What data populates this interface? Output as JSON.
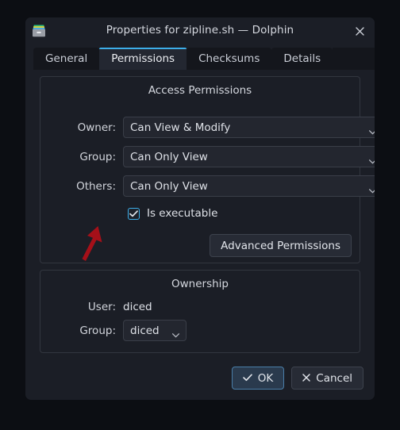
{
  "window": {
    "title": "Properties for zipline.sh — Dolphin",
    "icon": "file-properties-icon",
    "close_label": "✕"
  },
  "tabs": [
    {
      "label": "General",
      "active": false
    },
    {
      "label": "Permissions",
      "active": true
    },
    {
      "label": "Checksums",
      "active": false
    },
    {
      "label": "Details",
      "active": false
    }
  ],
  "access_permissions": {
    "title": "Access Permissions",
    "rows": [
      {
        "label": "Owner:",
        "value": "Can View & Modify"
      },
      {
        "label": "Group:",
        "value": "Can Only View"
      },
      {
        "label": "Others:",
        "value": "Can Only View"
      }
    ],
    "executable": {
      "label": "Is executable",
      "checked": true
    },
    "advanced_button": "Advanced Permissions"
  },
  "ownership": {
    "title": "Ownership",
    "user_label": "User:",
    "user_value": "diced",
    "group_label": "Group:",
    "group_value": "diced"
  },
  "footer": {
    "ok_label": "OK",
    "ok_icon": "checkmark-icon",
    "cancel_label": "Cancel",
    "cancel_icon": "cross-icon"
  },
  "annotation": {
    "type": "arrow-up-right",
    "color": "#a51019",
    "points_to": "is-executable-checkbox"
  },
  "colors": {
    "accent": "#3daee9",
    "dialog_bg": "#1b1e26",
    "backdrop": "#0c0e13",
    "annotation_red": "#a51019"
  }
}
